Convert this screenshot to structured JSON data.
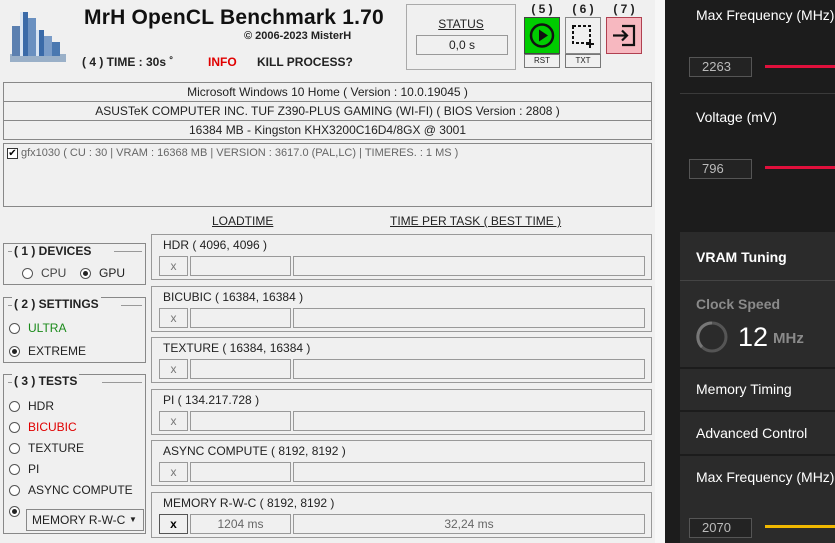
{
  "app": {
    "title": "MrH OpenCL Benchmark 1.70",
    "copyright": "2006-2023 MisterH",
    "time": "( 4 ) TIME : 30s ˚",
    "info": "INFO",
    "kill": "KILL PROCESS?",
    "status_label": "STATUS",
    "status_value": "0,0 s"
  },
  "toolbar": [
    {
      "num": "( 5 )",
      "label": "RST",
      "icon": "play-icon",
      "bg": "#00cc00"
    },
    {
      "num": "( 6 )",
      "label": "TXT",
      "icon": "crop-icon",
      "bg": "#f0f0f0"
    },
    {
      "num": "( 7 )",
      "label": "",
      "icon": "exit-icon",
      "bg": "#f7b8c0"
    }
  ],
  "sysinfo": [
    "Microsoft Windows 10 Home ( Version : 10.0.19045 )",
    "ASUSTeK COMPUTER INC. TUF Z390-PLUS GAMING (WI-FI) ( BIOS Version : 2808 )",
    "16384 MB - Kingston KHX3200C16D4/8GX     @ 3001"
  ],
  "gpu": {
    "checked": true,
    "label": "gfx1030 ( CU : 30 | VRAM : 16368 MB | VERSION : 3617.0 (PAL,LC) | TIMERES. : 1 MS )"
  },
  "columns": {
    "loadtime": "LOADTIME",
    "task": "TIME PER TASK ( BEST TIME )"
  },
  "devices": {
    "title": "( 1 ) DEVICES",
    "options": [
      {
        "label": "CPU",
        "selected": false
      },
      {
        "label": "GPU",
        "selected": true
      }
    ]
  },
  "settings": {
    "title": "( 2 ) SETTINGS",
    "options": [
      {
        "label": "ULTRA",
        "selected": false,
        "color": "#1a8a1a"
      },
      {
        "label": "EXTREME",
        "selected": true,
        "color": "#222222"
      }
    ]
  },
  "tests": {
    "title": "( 3 ) TESTS",
    "options": [
      {
        "label": "HDR",
        "selected": false,
        "color": "#222222"
      },
      {
        "label": "BICUBIC",
        "selected": false,
        "color": "#e00000"
      },
      {
        "label": "TEXTURE",
        "selected": false,
        "color": "#222222"
      },
      {
        "label": "PI",
        "selected": false,
        "color": "#222222"
      },
      {
        "label": "ASYNC COMPUTE",
        "selected": false,
        "color": "#222222"
      },
      {
        "label": "MEMORY R-W-C",
        "selected": true,
        "color": "#222222"
      }
    ],
    "combo_value": "MEMORY R-W-C"
  },
  "panels": [
    {
      "title": "HDR ( 4096, 4096 )",
      "x": "x",
      "load": "",
      "task": "",
      "active": false
    },
    {
      "title": "BICUBIC ( 16384, 16384 )",
      "x": "x",
      "load": "",
      "task": "",
      "active": false
    },
    {
      "title": "TEXTURE ( 16384, 16384 )",
      "x": "x",
      "load": "",
      "task": "",
      "active": false
    },
    {
      "title": "PI ( 134.217.728 )",
      "x": "x",
      "load": "",
      "task": "",
      "active": false
    },
    {
      "title": "ASYNC COMPUTE ( 8192, 8192 )",
      "x": "x",
      "load": "",
      "task": "",
      "active": false
    },
    {
      "title": "MEMORY R-W-C ( 8192, 8192 )",
      "x": "x",
      "load": "1204 ms",
      "task": "32,24 ms",
      "active": true
    }
  ],
  "right": {
    "max_freq_label": "Max Frequency (MHz)",
    "max_freq_value": "2263",
    "voltage_label": "Voltage (mV)",
    "voltage_value": "796",
    "vram_title": "VRAM Tuning",
    "clock_label": "Clock Speed",
    "clock_value": "12",
    "clock_unit": "MHz",
    "memory_timing": "Memory Timing",
    "advanced": "Advanced Control",
    "vram_max_freq_label": "Max Frequency (MHz)",
    "vram_max_freq_value": "2070",
    "colors": {
      "red_slider": "#e0103c",
      "yellow_slider": "#f0b800"
    }
  }
}
